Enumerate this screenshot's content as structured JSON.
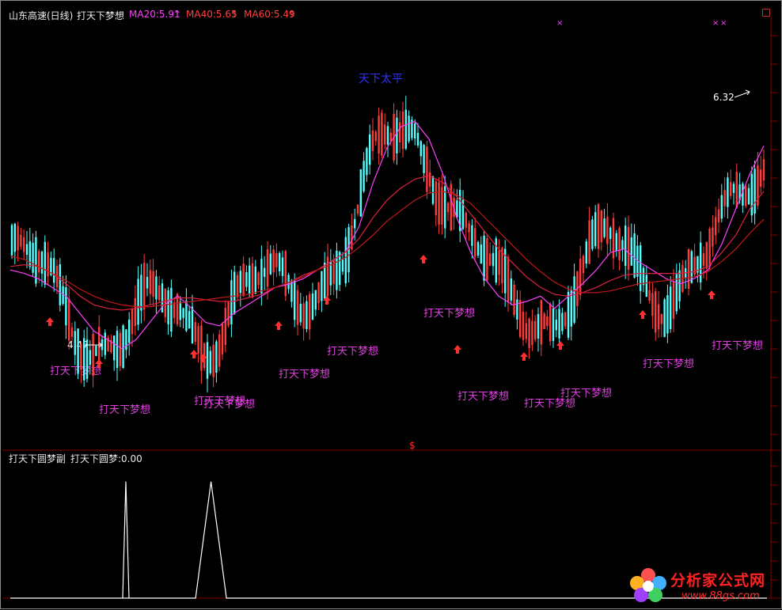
{
  "header": {
    "stock": "山东高速(日线)",
    "indicator": "打天下梦想",
    "ma": [
      {
        "label": "MA20:5.91",
        "arrow": "↑",
        "color": "#ff40ff"
      },
      {
        "label": "MA40:5.65",
        "arrow": "↑",
        "color": "#ff4040"
      },
      {
        "label": "MA60:5.49",
        "arrow": "↑",
        "color": "#ff4040"
      }
    ]
  },
  "sub_header": {
    "name": "打天下圆梦副",
    "value_label": "打天下圆梦:0.00"
  },
  "annotations": {
    "top_text": "天下太平",
    "low_price": "4.47",
    "high_price": "6.32",
    "divider_mark": "$",
    "signal_text": "打天下梦想",
    "x_marks": [
      "×",
      "×",
      "×"
    ]
  },
  "colors": {
    "up": "#ff3c3c",
    "down": "#54ffff",
    "ma20": "#ff40ff",
    "ma40": "#e02040",
    "ma60": "#c01818",
    "grid": "#800000",
    "signal": "#e040e0",
    "arrow": "#ff3030"
  },
  "logo": {
    "name": "分析家公式网",
    "url": "www.88gs.com",
    "icon": "flower-icon"
  },
  "chart_data": [
    {
      "type": "line",
      "series": [
        {
          "name": "MA20",
          "values": [
            5.2,
            5.18,
            5.15,
            5.1,
            5.05,
            4.95,
            4.85,
            4.8,
            4.75,
            4.8,
            4.9,
            5.0,
            5.05,
            4.98,
            4.9,
            4.88,
            4.95,
            5.0,
            5.05,
            5.1,
            5.12,
            5.15,
            5.2,
            5.25,
            5.3,
            5.45,
            5.7,
            5.9,
            6.02,
            6.05,
            5.95,
            5.75,
            5.5,
            5.3,
            5.15,
            5.05,
            5.0,
            5.02,
            5.05,
            4.98,
            5.05,
            5.12,
            5.2,
            5.3,
            5.32,
            5.25,
            5.2,
            5.15,
            5.12,
            5.15,
            5.2,
            5.35,
            5.55,
            5.75,
            5.91
          ]
        },
        {
          "name": "MA40",
          "values": [
            5.22,
            5.23,
            5.22,
            5.18,
            5.12,
            5.05,
            5.0,
            4.98,
            4.97,
            4.98,
            5.0,
            5.02,
            5.04,
            5.04,
            5.03,
            5.02,
            5.02,
            5.04,
            5.06,
            5.1,
            5.13,
            5.17,
            5.2,
            5.25,
            5.3,
            5.38,
            5.5,
            5.6,
            5.67,
            5.72,
            5.74,
            5.7,
            5.62,
            5.52,
            5.42,
            5.32,
            5.24,
            5.16,
            5.1,
            5.06,
            5.05,
            5.07,
            5.1,
            5.14,
            5.17,
            5.18,
            5.18,
            5.18,
            5.18,
            5.19,
            5.22,
            5.3,
            5.4,
            5.55,
            5.65
          ]
        },
        {
          "name": "MA60",
          "values": [
            5.28,
            5.26,
            5.22,
            5.18,
            5.14,
            5.09,
            5.05,
            5.02,
            5.0,
            4.99,
            4.99,
            5.0,
            5.01,
            5.02,
            5.03,
            5.04,
            5.05,
            5.06,
            5.08,
            5.1,
            5.13,
            5.16,
            5.2,
            5.23,
            5.27,
            5.33,
            5.4,
            5.48,
            5.54,
            5.6,
            5.64,
            5.65,
            5.63,
            5.58,
            5.5,
            5.42,
            5.34,
            5.26,
            5.19,
            5.13,
            5.09,
            5.07,
            5.07,
            5.08,
            5.1,
            5.12,
            5.13,
            5.14,
            5.15,
            5.16,
            5.19,
            5.25,
            5.32,
            5.41,
            5.49
          ]
        }
      ],
      "ylim": [
        4.25,
        6.65
      ]
    },
    {
      "type": "line",
      "series": [
        {
          "name": "打天下圆梦",
          "values": [
            0,
            0,
            0,
            0,
            0,
            0,
            0,
            0,
            0,
            0,
            0,
            0,
            0,
            1,
            0,
            0,
            0,
            0,
            0,
            0,
            0,
            0,
            0,
            0,
            0,
            0,
            0,
            0,
            0,
            0,
            0,
            0,
            0,
            0,
            0,
            0,
            0,
            0,
            0,
            0,
            0,
            0,
            0,
            0,
            0,
            0,
            0,
            0,
            0,
            0
          ]
        }
      ],
      "ylim": [
        0,
        1.12
      ]
    }
  ]
}
